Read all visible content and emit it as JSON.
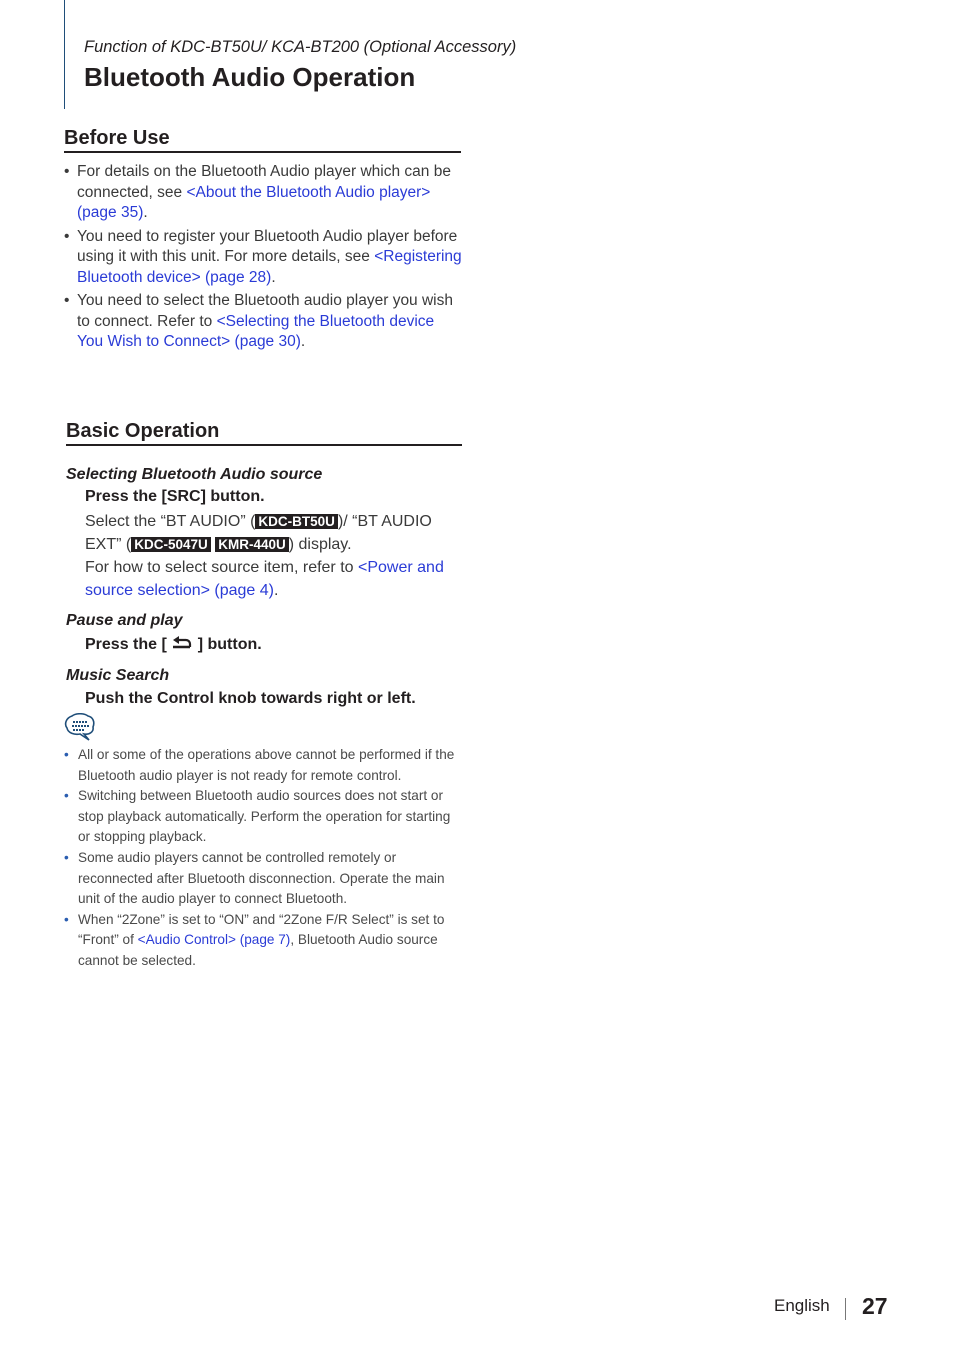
{
  "header": {
    "function_line": "Function of KDC-BT50U/ KCA-BT200 (Optional Accessory)",
    "title": "Bluetooth Audio Operation"
  },
  "before_use": {
    "heading": "Before Use",
    "items": [
      {
        "text": "For details on the Bluetooth Audio player which can be connected, see ",
        "link": "<About the Bluetooth Audio player> (page 35)",
        "after": "."
      },
      {
        "text": "You need to register your Bluetooth Audio player before using it with this unit. For more details, see ",
        "link": "<Registering Bluetooth device> (page 28)",
        "after": "."
      },
      {
        "text": "You need to select the Bluetooth audio player you wish to connect. Refer to ",
        "link": "<Selecting the Bluetooth device You Wish to Connect> (page 30)",
        "after": "."
      }
    ]
  },
  "basic_operation": {
    "heading": "Basic Operation",
    "selecting": {
      "title": "Selecting Bluetooth Audio source",
      "step": "Press the [SRC] button.",
      "line1_a": "Select the “BT AUDIO” (",
      "badge1": "KDC-BT50U",
      "line1_b": ")/ “BT AUDIO EXT” (",
      "badge2": "KDC-5047U",
      "badge3": "KMR-440U",
      "line1_c": ") display.",
      "line2_a": "For how to select source item, refer to ",
      "line2_link": "<Power and source selection> (page 4)",
      "line2_b": "."
    },
    "pause": {
      "title": "Pause and play",
      "step_a": "Press the [ ",
      "step_icon": "return-arrow-icon",
      "step_b": " ] button."
    },
    "search": {
      "title": "Music Search",
      "step": "Push the Control knob towards right or left."
    }
  },
  "notes": {
    "icon": "note-speech-bubble-icon",
    "items": [
      {
        "text": "All or some of the operations above cannot be performed if the Bluetooth audio player is not ready for remote control.",
        "link": "",
        "after": ""
      },
      {
        "text": "Switching between Bluetooth audio sources does not start or stop playback automatically. Perform the operation for starting or stopping playback.",
        "link": "",
        "after": ""
      },
      {
        "text": "Some audio players cannot be controlled remotely or reconnected after Bluetooth disconnection. Operate the main unit of the audio player to connect Bluetooth.",
        "link": "",
        "after": ""
      },
      {
        "text": "When “2Zone” is set to “ON” and “2Zone F/R Select” is set to “Front” of ",
        "link": "<Audio Control> (page 7)",
        "after": ", Bluetooth Audio source cannot be selected."
      }
    ]
  },
  "footer": {
    "language": "English",
    "page": "27"
  },
  "colors": {
    "link": "#2a3bd6",
    "text": "#231f20",
    "accent_line": "#1f4e79"
  }
}
